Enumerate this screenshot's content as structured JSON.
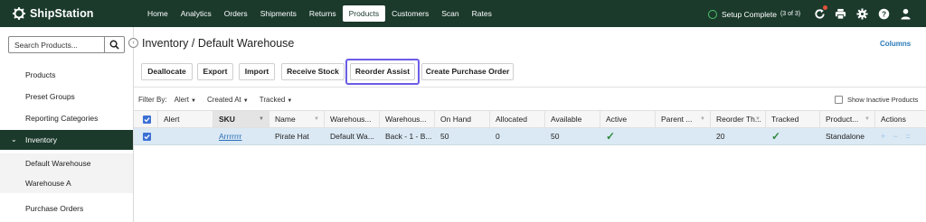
{
  "app": {
    "logo_text": "ShipStation"
  },
  "nav": {
    "items": [
      {
        "label": "Home"
      },
      {
        "label": "Analytics"
      },
      {
        "label": "Orders"
      },
      {
        "label": "Shipments"
      },
      {
        "label": "Returns"
      },
      {
        "label": "Products",
        "active": true
      },
      {
        "label": "Customers"
      },
      {
        "label": "Scan"
      },
      {
        "label": "Rates"
      }
    ],
    "setup_label": "Setup Complete",
    "setup_count": "(3 of 3)",
    "icons": [
      "refresh-notification-icon",
      "printer-icon",
      "gear-icon",
      "help-icon",
      "user-icon"
    ]
  },
  "sidebar": {
    "search_placeholder": "Search Products...",
    "items": [
      {
        "label": "Products"
      },
      {
        "label": "Preset Groups"
      },
      {
        "label": "Reporting Categories"
      },
      {
        "label": "Inventory",
        "expanded": true
      },
      {
        "label": "Default Warehouse"
      },
      {
        "label": "Warehouse A"
      },
      {
        "label": "Purchase Orders"
      }
    ]
  },
  "main": {
    "title": "Inventory / Default Warehouse",
    "columns_link": "Columns",
    "buttons": [
      {
        "label": "Deallocate"
      },
      {
        "label": "Export"
      },
      {
        "label": "Import"
      },
      {
        "label": "Receive Stock"
      },
      {
        "label": "Reorder Assist",
        "highlighted": true
      },
      {
        "label": "Create Purchase Order"
      }
    ],
    "filter": {
      "label": "Filter By:",
      "dropdowns": [
        "Alert",
        "Created At",
        "Tracked"
      ],
      "show_inactive": "Show Inactive Products"
    }
  },
  "grid": {
    "columns": [
      "Alert",
      "SKU",
      "Name",
      "Warehous...",
      "Warehous...",
      "On Hand",
      "Allocated",
      "Available",
      "Active",
      "Parent ...",
      "Reorder Th...",
      "Tracked",
      "Product...",
      "Actions"
    ],
    "rows": [
      {
        "selected": true,
        "sku": "Arrrrrrr",
        "name": "Pirate Hat",
        "warehouse": "Default Wa...",
        "location": "Back - 1 - B...",
        "on_hand": "50",
        "allocated": "0",
        "available": "50",
        "active": true,
        "parent": "",
        "reorder_threshold": "20",
        "tracked": true,
        "product_type": "Standalone",
        "actions": "+ − ="
      }
    ]
  },
  "colors": {
    "nav_bg": "#1b3a2c",
    "accent_blue": "#3b6fd4",
    "link_blue": "#2a6fb8",
    "highlight_purple": "#6b5ce7",
    "row_selected": "#dbe9f4",
    "check_green": "#2e8b3e",
    "setup_green": "#4cc46a"
  }
}
